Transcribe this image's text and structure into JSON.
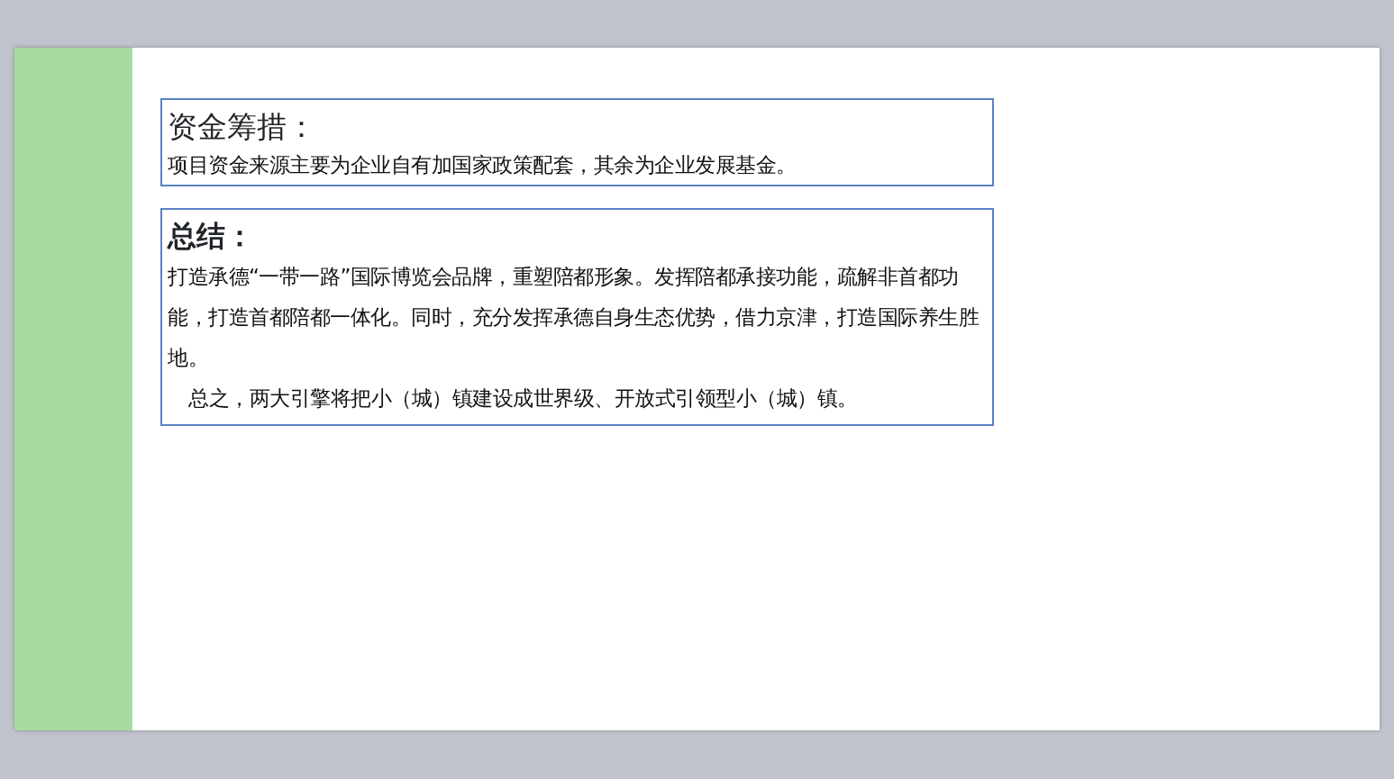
{
  "slide": {
    "sections": [
      {
        "kind": "serif",
        "title": "资金筹措：",
        "paragraphs": [
          "项目资金来源主要为企业自有加国家政策配套，其余为企业发展基金。"
        ]
      },
      {
        "kind": "bold",
        "title": "总结：",
        "paragraphs": [
          "打造承德“一带一路”国际博览会品牌，重塑陪都形象。发挥陪都承接功能，疏解非首都功能，打造首都陪都一体化。同时，充分发挥承德自身生态优势，借力京津，打造国际养生胜地。",
          "总之，两大引擎将把小（城）镇建设成世界级、开放式引领型小（城）镇。"
        ]
      }
    ]
  }
}
